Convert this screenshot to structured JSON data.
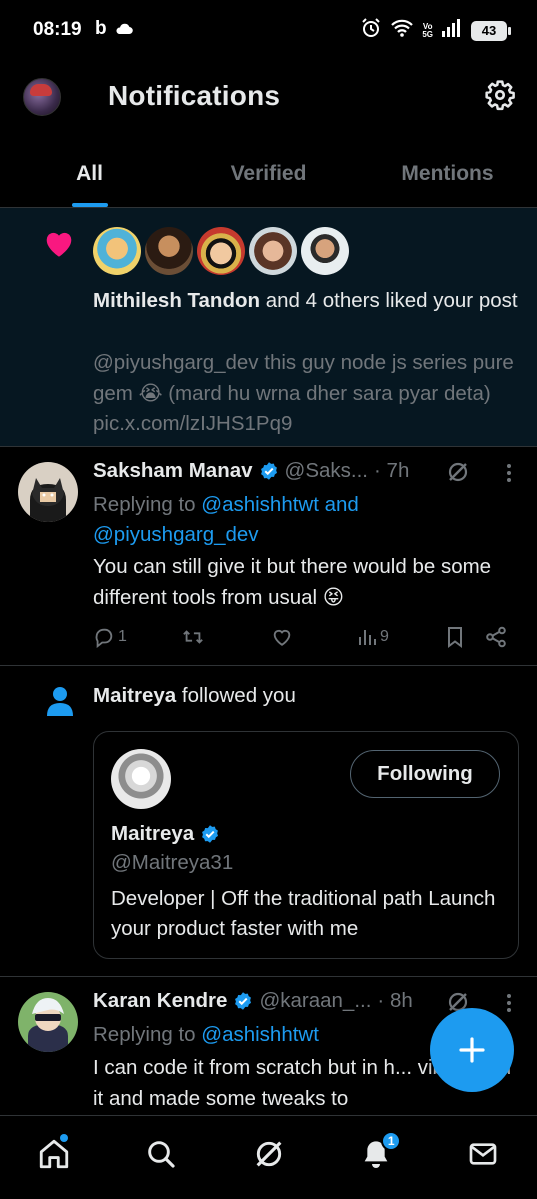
{
  "status_bar": {
    "time": "08:19",
    "b_icon": "b",
    "volte": "Vo 5G",
    "battery": "43"
  },
  "header": {
    "title": "Notifications"
  },
  "tabs": [
    {
      "label": "All",
      "active": true
    },
    {
      "label": "Verified",
      "active": false
    },
    {
      "label": "Mentions",
      "active": false
    }
  ],
  "like_notification": {
    "actor": "Mithilesh Tandon",
    "action": " and 4 others liked your post",
    "quote": "@piyushgarg_dev  this guy node js series pure gem 😭 (mard hu wrna dher sara pyar deta) pic.x.com/lzIJHS1Pq9"
  },
  "tweet1": {
    "name": "Saksham Manav",
    "handle": "@Saks...",
    "time": "· 7h",
    "replying_prefix": "Replying to ",
    "replying_to": "@ashishhtwt and @piyushgarg_dev",
    "body": "You can still give it but there would be some different tools from usual 😝",
    "reply_count": "1",
    "view_count": "9"
  },
  "follow_notification": {
    "actor": "Maitreya",
    "action": " followed you",
    "button": "Following",
    "name": "Maitreya",
    "handle": "@Maitreya31",
    "bio": "Developer | Off the traditional path Launch your product faster with me"
  },
  "tweet2": {
    "name": "Karan Kendre",
    "handle": "@karaan_...",
    "time": "· 8h",
    "replying_prefix": "Replying to ",
    "replying_to": "@ashishhtwt",
    "body": "I can code it from scratch but in h... vibecoded it and made some tweaks to"
  },
  "bottom_nav": {
    "notification_badge": "1"
  },
  "colors": {
    "accent": "#1d9bf0",
    "like": "#f91880",
    "muted": "#71767b",
    "highlight_bg": "#061721"
  }
}
